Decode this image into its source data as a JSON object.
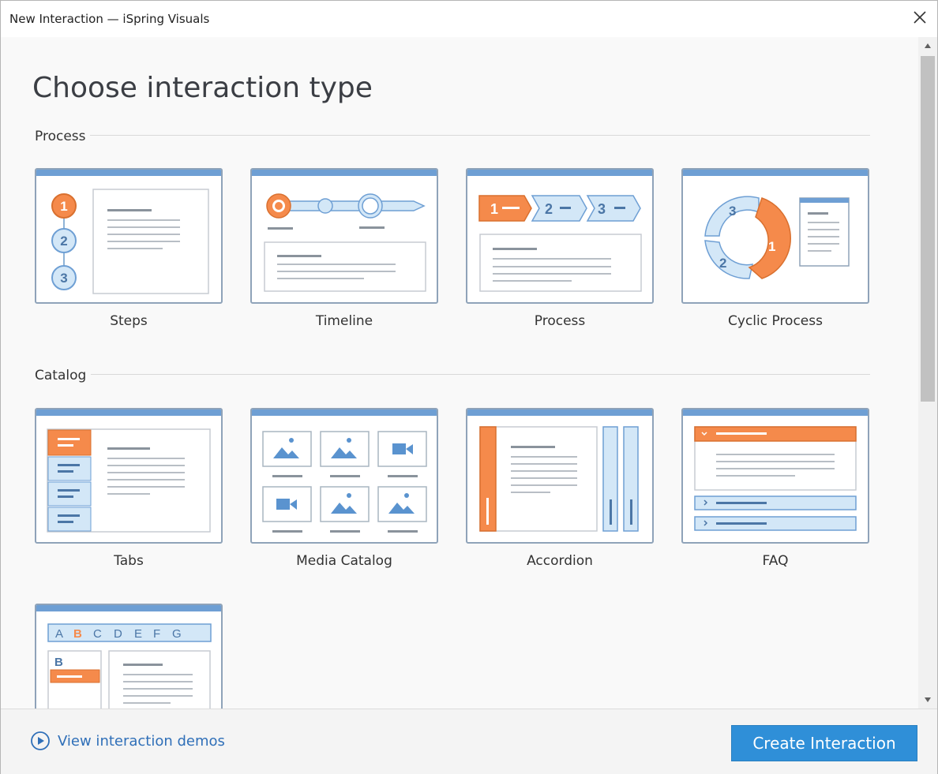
{
  "window": {
    "title": "New Interaction — iSpring Visuals"
  },
  "main": {
    "heading": "Choose interaction type",
    "sections": [
      {
        "title": "Process",
        "items": [
          {
            "label": "Steps",
            "icon": "steps-thumbnail-icon"
          },
          {
            "label": "Timeline",
            "icon": "timeline-thumbnail-icon"
          },
          {
            "label": "Process",
            "icon": "process-thumbnail-icon"
          },
          {
            "label": "Cyclic Process",
            "icon": "cyclic-process-thumbnail-icon"
          }
        ]
      },
      {
        "title": "Catalog",
        "items": [
          {
            "label": "Tabs",
            "icon": "tabs-thumbnail-icon"
          },
          {
            "label": "Media Catalog",
            "icon": "media-catalog-thumbnail-icon"
          },
          {
            "label": "Accordion",
            "icon": "accordion-thumbnail-icon"
          },
          {
            "label": "FAQ",
            "icon": "faq-thumbnail-icon"
          },
          {
            "label": "",
            "icon": "glossary-thumbnail-icon"
          }
        ]
      }
    ],
    "thumbnail_text": {
      "step_numbers": [
        "1",
        "2",
        "3"
      ],
      "process_numbers": [
        "1",
        "2",
        "3"
      ],
      "cyclic_numbers": [
        "3",
        "2",
        "1"
      ],
      "alphabet": [
        "A",
        "B",
        "C",
        "D",
        "E",
        "F",
        "G"
      ],
      "glossary_letter": "B"
    }
  },
  "footer": {
    "demo_link": "View interaction demos",
    "create_button": "Create Interaction"
  },
  "colors": {
    "accent_blue": "#2f8fd8",
    "thumbnail_header": "#6e9fd4",
    "thumbnail_orange": "#f58a4b",
    "thumbnail_light_blue": "#d3e7f7",
    "link_blue": "#2f6fb8"
  }
}
